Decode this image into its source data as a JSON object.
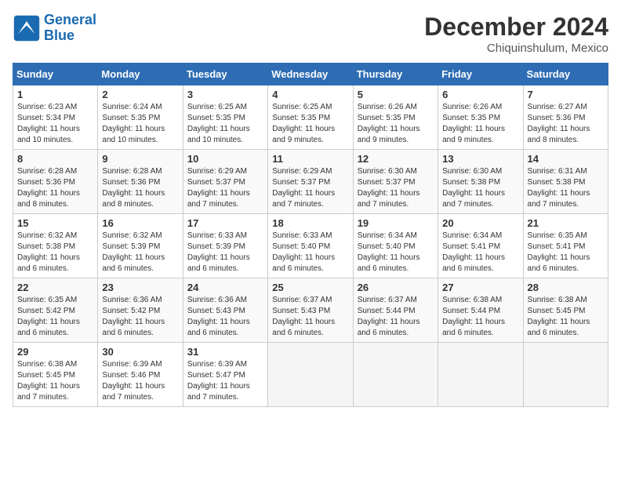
{
  "header": {
    "logo_line1": "General",
    "logo_line2": "Blue",
    "month_year": "December 2024",
    "location": "Chiquinshulum, Mexico"
  },
  "days_of_week": [
    "Sunday",
    "Monday",
    "Tuesday",
    "Wednesday",
    "Thursday",
    "Friday",
    "Saturday"
  ],
  "weeks": [
    [
      {
        "day": "1",
        "info": "Sunrise: 6:23 AM\nSunset: 5:34 PM\nDaylight: 11 hours\nand 10 minutes."
      },
      {
        "day": "2",
        "info": "Sunrise: 6:24 AM\nSunset: 5:35 PM\nDaylight: 11 hours\nand 10 minutes."
      },
      {
        "day": "3",
        "info": "Sunrise: 6:25 AM\nSunset: 5:35 PM\nDaylight: 11 hours\nand 10 minutes."
      },
      {
        "day": "4",
        "info": "Sunrise: 6:25 AM\nSunset: 5:35 PM\nDaylight: 11 hours\nand 9 minutes."
      },
      {
        "day": "5",
        "info": "Sunrise: 6:26 AM\nSunset: 5:35 PM\nDaylight: 11 hours\nand 9 minutes."
      },
      {
        "day": "6",
        "info": "Sunrise: 6:26 AM\nSunset: 5:35 PM\nDaylight: 11 hours\nand 9 minutes."
      },
      {
        "day": "7",
        "info": "Sunrise: 6:27 AM\nSunset: 5:36 PM\nDaylight: 11 hours\nand 8 minutes."
      }
    ],
    [
      {
        "day": "8",
        "info": "Sunrise: 6:28 AM\nSunset: 5:36 PM\nDaylight: 11 hours\nand 8 minutes."
      },
      {
        "day": "9",
        "info": "Sunrise: 6:28 AM\nSunset: 5:36 PM\nDaylight: 11 hours\nand 8 minutes."
      },
      {
        "day": "10",
        "info": "Sunrise: 6:29 AM\nSunset: 5:37 PM\nDaylight: 11 hours\nand 7 minutes."
      },
      {
        "day": "11",
        "info": "Sunrise: 6:29 AM\nSunset: 5:37 PM\nDaylight: 11 hours\nand 7 minutes."
      },
      {
        "day": "12",
        "info": "Sunrise: 6:30 AM\nSunset: 5:37 PM\nDaylight: 11 hours\nand 7 minutes."
      },
      {
        "day": "13",
        "info": "Sunrise: 6:30 AM\nSunset: 5:38 PM\nDaylight: 11 hours\nand 7 minutes."
      },
      {
        "day": "14",
        "info": "Sunrise: 6:31 AM\nSunset: 5:38 PM\nDaylight: 11 hours\nand 7 minutes."
      }
    ],
    [
      {
        "day": "15",
        "info": "Sunrise: 6:32 AM\nSunset: 5:38 PM\nDaylight: 11 hours\nand 6 minutes."
      },
      {
        "day": "16",
        "info": "Sunrise: 6:32 AM\nSunset: 5:39 PM\nDaylight: 11 hours\nand 6 minutes."
      },
      {
        "day": "17",
        "info": "Sunrise: 6:33 AM\nSunset: 5:39 PM\nDaylight: 11 hours\nand 6 minutes."
      },
      {
        "day": "18",
        "info": "Sunrise: 6:33 AM\nSunset: 5:40 PM\nDaylight: 11 hours\nand 6 minutes."
      },
      {
        "day": "19",
        "info": "Sunrise: 6:34 AM\nSunset: 5:40 PM\nDaylight: 11 hours\nand 6 minutes."
      },
      {
        "day": "20",
        "info": "Sunrise: 6:34 AM\nSunset: 5:41 PM\nDaylight: 11 hours\nand 6 minutes."
      },
      {
        "day": "21",
        "info": "Sunrise: 6:35 AM\nSunset: 5:41 PM\nDaylight: 11 hours\nand 6 minutes."
      }
    ],
    [
      {
        "day": "22",
        "info": "Sunrise: 6:35 AM\nSunset: 5:42 PM\nDaylight: 11 hours\nand 6 minutes."
      },
      {
        "day": "23",
        "info": "Sunrise: 6:36 AM\nSunset: 5:42 PM\nDaylight: 11 hours\nand 6 minutes."
      },
      {
        "day": "24",
        "info": "Sunrise: 6:36 AM\nSunset: 5:43 PM\nDaylight: 11 hours\nand 6 minutes."
      },
      {
        "day": "25",
        "info": "Sunrise: 6:37 AM\nSunset: 5:43 PM\nDaylight: 11 hours\nand 6 minutes."
      },
      {
        "day": "26",
        "info": "Sunrise: 6:37 AM\nSunset: 5:44 PM\nDaylight: 11 hours\nand 6 minutes."
      },
      {
        "day": "27",
        "info": "Sunrise: 6:38 AM\nSunset: 5:44 PM\nDaylight: 11 hours\nand 6 minutes."
      },
      {
        "day": "28",
        "info": "Sunrise: 6:38 AM\nSunset: 5:45 PM\nDaylight: 11 hours\nand 6 minutes."
      }
    ],
    [
      {
        "day": "29",
        "info": "Sunrise: 6:38 AM\nSunset: 5:45 PM\nDaylight: 11 hours\nand 7 minutes."
      },
      {
        "day": "30",
        "info": "Sunrise: 6:39 AM\nSunset: 5:46 PM\nDaylight: 11 hours\nand 7 minutes."
      },
      {
        "day": "31",
        "info": "Sunrise: 6:39 AM\nSunset: 5:47 PM\nDaylight: 11 hours\nand 7 minutes."
      },
      null,
      null,
      null,
      null
    ]
  ]
}
